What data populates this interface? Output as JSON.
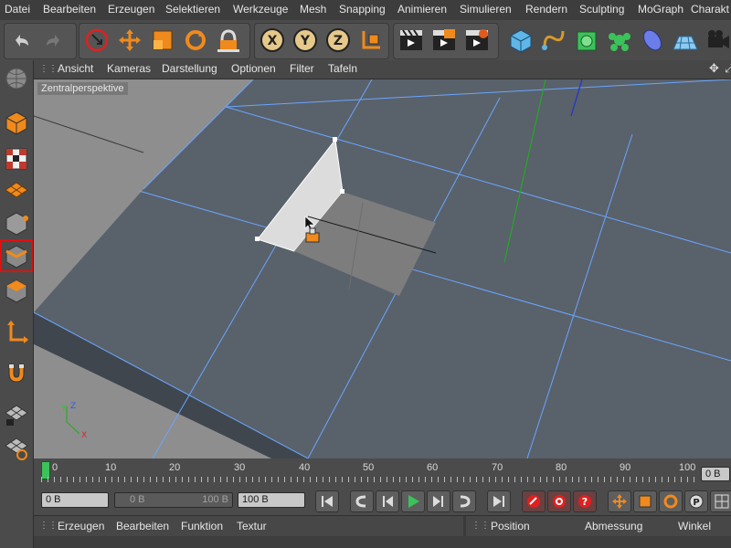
{
  "menubar": {
    "items": [
      "Datei",
      "Bearbeiten",
      "Erzeugen",
      "Selektieren",
      "Werkzeuge",
      "Mesh",
      "Snapping",
      "Animieren",
      "Simulieren",
      "Rendern",
      "Sculpting",
      "MoGraph",
      "Charakt"
    ]
  },
  "viewport": {
    "menu": [
      "Ansicht",
      "Kameras",
      "Darstellung",
      "Optionen",
      "Filter",
      "Tafeln"
    ],
    "label": "Zentralperspektive"
  },
  "timeline": {
    "ticks": [
      "0",
      "10",
      "20",
      "30",
      "40",
      "50",
      "60",
      "70",
      "80",
      "90",
      "100"
    ],
    "current": "0 B"
  },
  "transport": {
    "start": "0 B",
    "range_start": "0 B",
    "range_end": "100 B",
    "end": "100 B"
  },
  "object_manager": {
    "menu": [
      "Erzeugen",
      "Bearbeiten",
      "Funktion",
      "Textur"
    ]
  },
  "coordinates": {
    "headers": [
      "Position",
      "Abmessung",
      "Winkel"
    ]
  },
  "colors": {
    "accent": "#f08a1c",
    "active_outline": "#e01010",
    "viewport_bg": "#8f8f8f",
    "edge": "#6aa6ff"
  }
}
